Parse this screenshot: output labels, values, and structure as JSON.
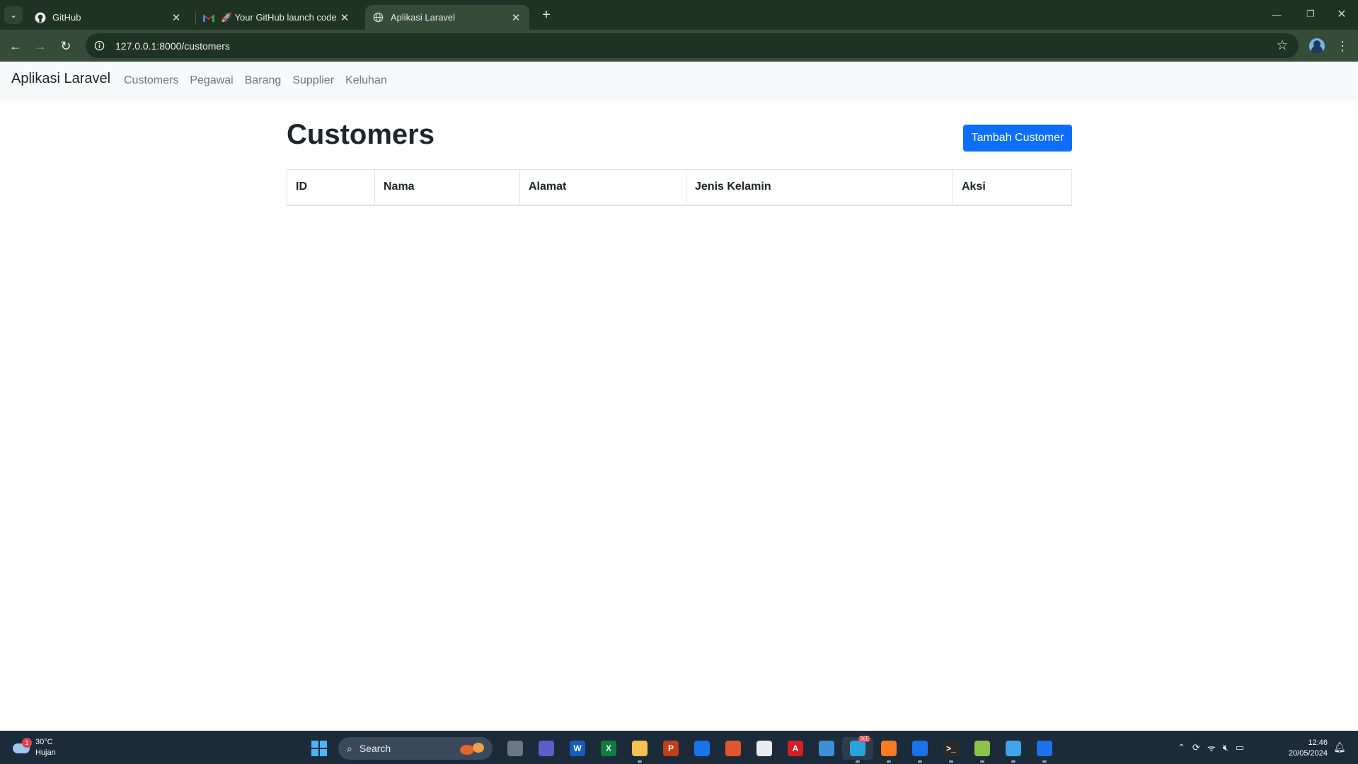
{
  "browser": {
    "tabs": [
      {
        "title": "GitHub",
        "icon": "github-icon",
        "active": false
      },
      {
        "title": "🚀 Your GitHub launch code - ",
        "icon": "gmail-icon",
        "active": false
      },
      {
        "title": "Aplikasi Laravel",
        "icon": "globe-icon",
        "active": true
      }
    ],
    "url": "127.0.0.1:8000/customers"
  },
  "navbar": {
    "brand": "Aplikasi Laravel",
    "links": [
      "Customers",
      "Pegawai",
      "Barang",
      "Supplier",
      "Keluhan"
    ]
  },
  "page": {
    "title": "Customers",
    "add_button": "Tambah Customer",
    "table": {
      "columns": [
        "ID",
        "Nama",
        "Alamat",
        "Jenis Kelamin",
        "Aksi"
      ],
      "rows": []
    }
  },
  "taskbar": {
    "weather": {
      "temp": "30°C",
      "condition": "Hujan",
      "badge": "1"
    },
    "search_label": "Search",
    "clock": {
      "time": "12:46",
      "date": "20/05/2024"
    },
    "apps": [
      {
        "name": "task-view",
        "label": "",
        "color": "#6b7785"
      },
      {
        "name": "teams",
        "label": "",
        "color": "#5b5fc7"
      },
      {
        "name": "word",
        "label": "W",
        "color": "#185abd"
      },
      {
        "name": "excel",
        "label": "X",
        "color": "#107c41"
      },
      {
        "name": "file-explorer",
        "label": "",
        "color": "#f2c14e"
      },
      {
        "name": "powerpoint",
        "label": "P",
        "color": "#c43e1c"
      },
      {
        "name": "chrome",
        "label": "",
        "color": "#1a73e8"
      },
      {
        "name": "office-app",
        "label": "",
        "color": "#e2552c"
      },
      {
        "name": "file",
        "label": "",
        "color": "#e8ecf0"
      },
      {
        "name": "acrobat",
        "label": "A",
        "color": "#d31f26"
      },
      {
        "name": "recycle",
        "label": "",
        "color": "#3d8fd6"
      },
      {
        "name": "telegram",
        "label": "",
        "color": "#2aa3d9"
      },
      {
        "name": "xampp",
        "label": "",
        "color": "#fb7a24"
      },
      {
        "name": "chrome-profile",
        "label": "",
        "color": "#1a73e8"
      },
      {
        "name": "terminal",
        "label": ">_",
        "color": "#2b2b2b"
      },
      {
        "name": "notepad-plus",
        "label": "",
        "color": "#8bc34a"
      },
      {
        "name": "notepad",
        "label": "",
        "color": "#3ea6e8"
      },
      {
        "name": "chrome-alt",
        "label": "",
        "color": "#1a73e8"
      }
    ],
    "telegram_badge": "365"
  }
}
